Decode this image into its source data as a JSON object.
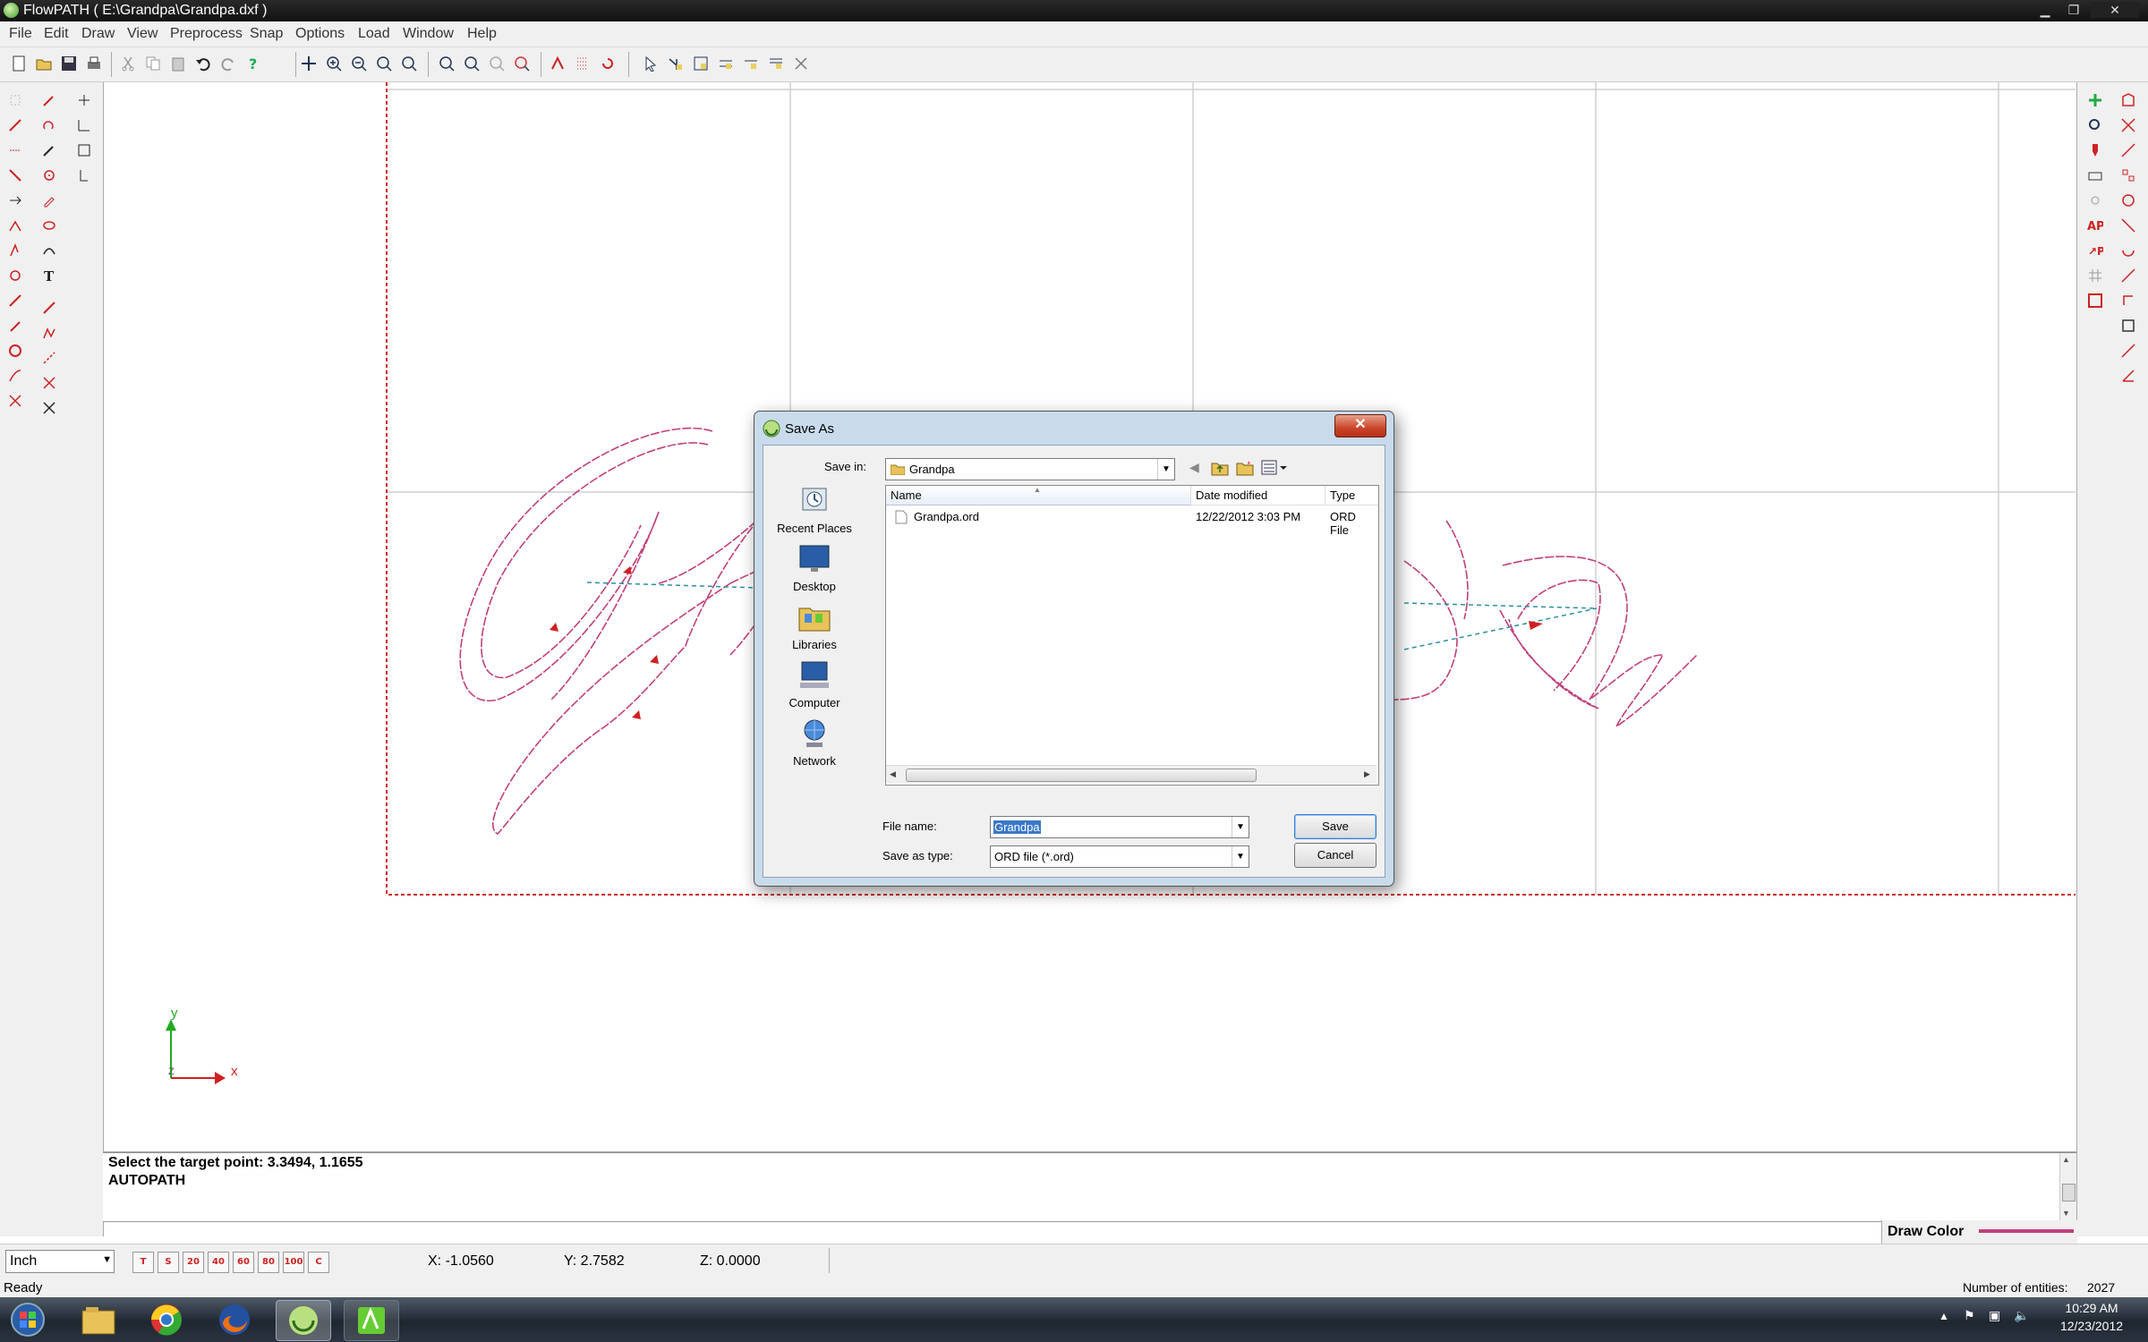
{
  "window": {
    "title": "FlowPATH ( E:\\Grandpa\\Grandpa.dxf )",
    "minimize_glyph": "▁",
    "maximize_glyph": "❐",
    "close_glyph": "✕"
  },
  "menu": [
    "File",
    "Edit",
    "Draw",
    "View",
    "Preprocess",
    "Snap",
    "Options",
    "Load",
    "Window",
    "Help"
  ],
  "command": {
    "line1": "Select the target point: 3.3494, 1.1655",
    "line2": "AUTOPATH"
  },
  "draw_color": {
    "label": "Draw Color",
    "color": "#c0407a"
  },
  "status": {
    "units": "Inch",
    "snap_buttons": [
      "T",
      "S",
      "20",
      "40",
      "60",
      "80",
      "100",
      "C"
    ],
    "x": "X: -1.0560",
    "y": "Y: 2.7582",
    "z": "Z: 0.0000",
    "ready": "Ready",
    "entities_label": "Number of entities:",
    "entities_value": "2027"
  },
  "axis": {
    "y": "y",
    "x": "x",
    "z": "Z"
  },
  "dialog": {
    "title": "Save As",
    "close_glyph": "✕",
    "save_in_label": "Save in:",
    "save_in_value": "Grandpa",
    "places": [
      "Recent Places",
      "Desktop",
      "Libraries",
      "Computer",
      "Network"
    ],
    "columns": [
      "Name",
      "Date modified",
      "Type"
    ],
    "files": [
      {
        "name": "Grandpa.ord",
        "date": "12/22/2012 3:03 PM",
        "type": "ORD File"
      }
    ],
    "file_name_label": "File name:",
    "file_name_value": "Grandpa",
    "save_type_label": "Save as type:",
    "save_type_value": "ORD file (*.ord)",
    "save_button": "Save",
    "cancel_button": "Cancel"
  },
  "clock": {
    "time": "10:29 AM",
    "date": "12/23/2012"
  }
}
